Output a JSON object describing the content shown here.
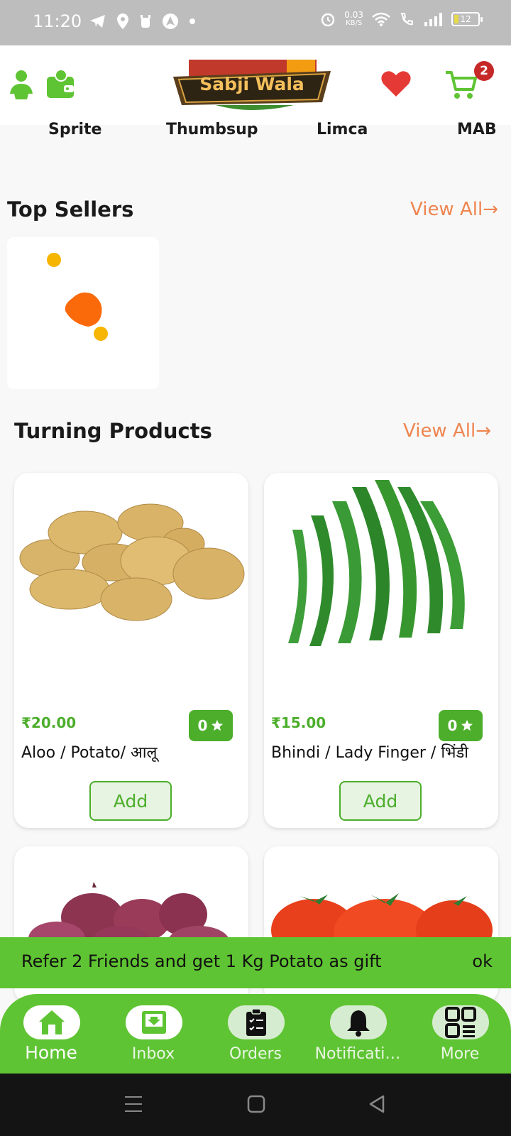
{
  "status_bar": {
    "time": "11:20",
    "net_speed_value": "0.03",
    "net_speed_unit": "KB/S",
    "battery": "12"
  },
  "header": {
    "logo_text": "Sabji Wala",
    "cart_count": "2"
  },
  "brands": [
    "Sprite",
    "Thumbsup",
    "Limca",
    "MAB"
  ],
  "sections": {
    "top_sellers": {
      "title": "Top Sellers",
      "view_all": "View All→"
    },
    "trending": {
      "title": "Turning Products",
      "view_all": "View All→"
    }
  },
  "products": [
    {
      "price": "₹20.00",
      "rating": "0",
      "name": "Aloo / Potato/ आलू",
      "add": "Add"
    },
    {
      "price": "₹15.00",
      "rating": "0",
      "name": "Bhindi / Lady Finger / भिंडी",
      "add": "Add"
    }
  ],
  "snackbar": {
    "message": "Refer 2 Friends and get 1 Kg Potato as gift",
    "action": "ok"
  },
  "bottom_nav": [
    {
      "label": "Home",
      "icon": "home-icon"
    },
    {
      "label": "Inbox",
      "icon": "inbox-icon"
    },
    {
      "label": "Orders",
      "icon": "orders-icon"
    },
    {
      "label": "Notificati…",
      "icon": "bell-icon"
    },
    {
      "label": "More",
      "icon": "grid-icon"
    }
  ],
  "colors": {
    "accent_green": "#5fc433",
    "price_green": "#4cae2b",
    "view_all_orange": "#ef8550",
    "badge_red": "#c62828",
    "heart_red": "#e53935"
  }
}
